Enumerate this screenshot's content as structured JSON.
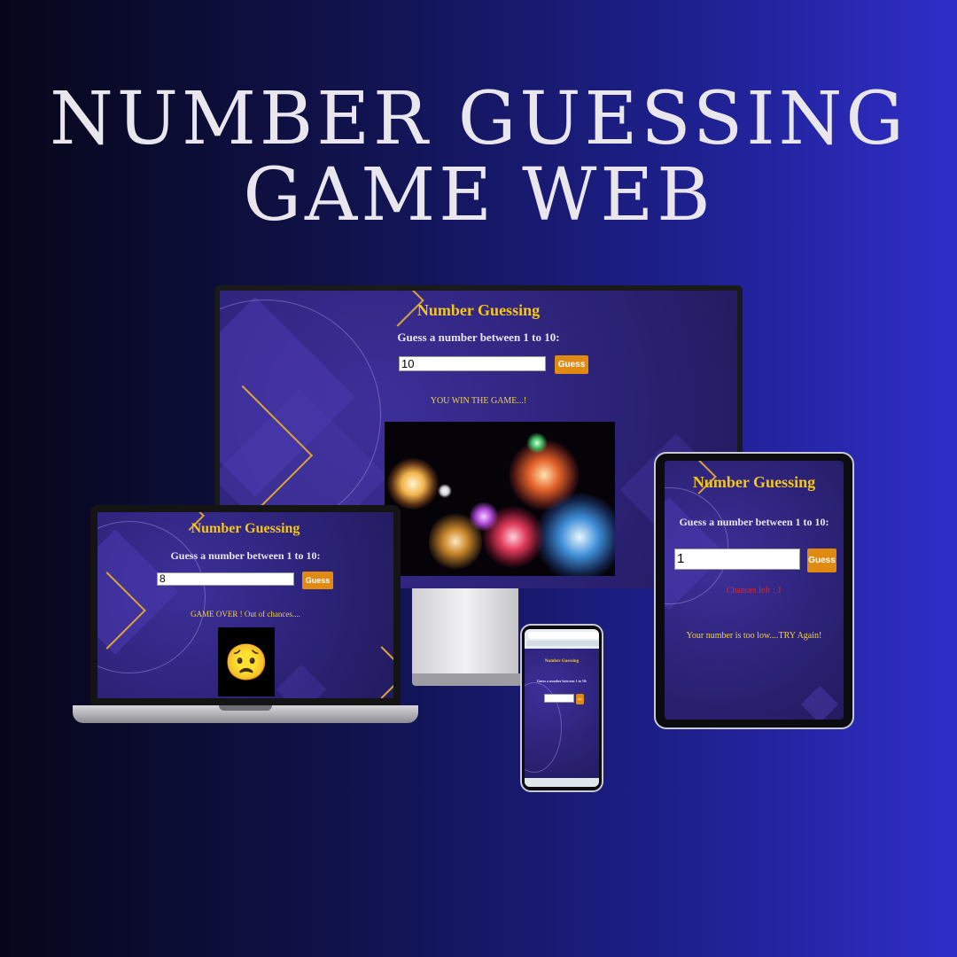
{
  "headline": {
    "line1": "NUMBER GUESSING",
    "line2": "GAME WEB"
  },
  "monitor": {
    "title": "Number Guessing",
    "prompt": "Guess a number between 1 to 10:",
    "input_value": "10",
    "button_label": "Guess",
    "message": "YOU WIN THE GAME...!",
    "message_color": "#f0d23a"
  },
  "laptop": {
    "title": "Number Guessing",
    "prompt": "Guess a number between 1 to 10:",
    "input_value": "8",
    "button_label": "Guess",
    "message": "GAME OVER ! Out of chances....",
    "message_color": "#f0d23a",
    "emoji": "😟"
  },
  "tablet": {
    "title": "Number Guessing",
    "prompt": "Guess a number between 1 to 10:",
    "input_value": "1",
    "button_label": "Guess",
    "chances": "Chances left : 1",
    "chances_color": "#e02525",
    "message": "Your number is too low....TRY Again!",
    "message_color": "#f0d23a"
  },
  "phone": {
    "title": "Number Guessing",
    "prompt": "Guess a number between 1 to 10:",
    "button_label": "Gu"
  },
  "colors": {
    "accent_gold": "#f5c518",
    "button_orange": "#e08a12"
  }
}
